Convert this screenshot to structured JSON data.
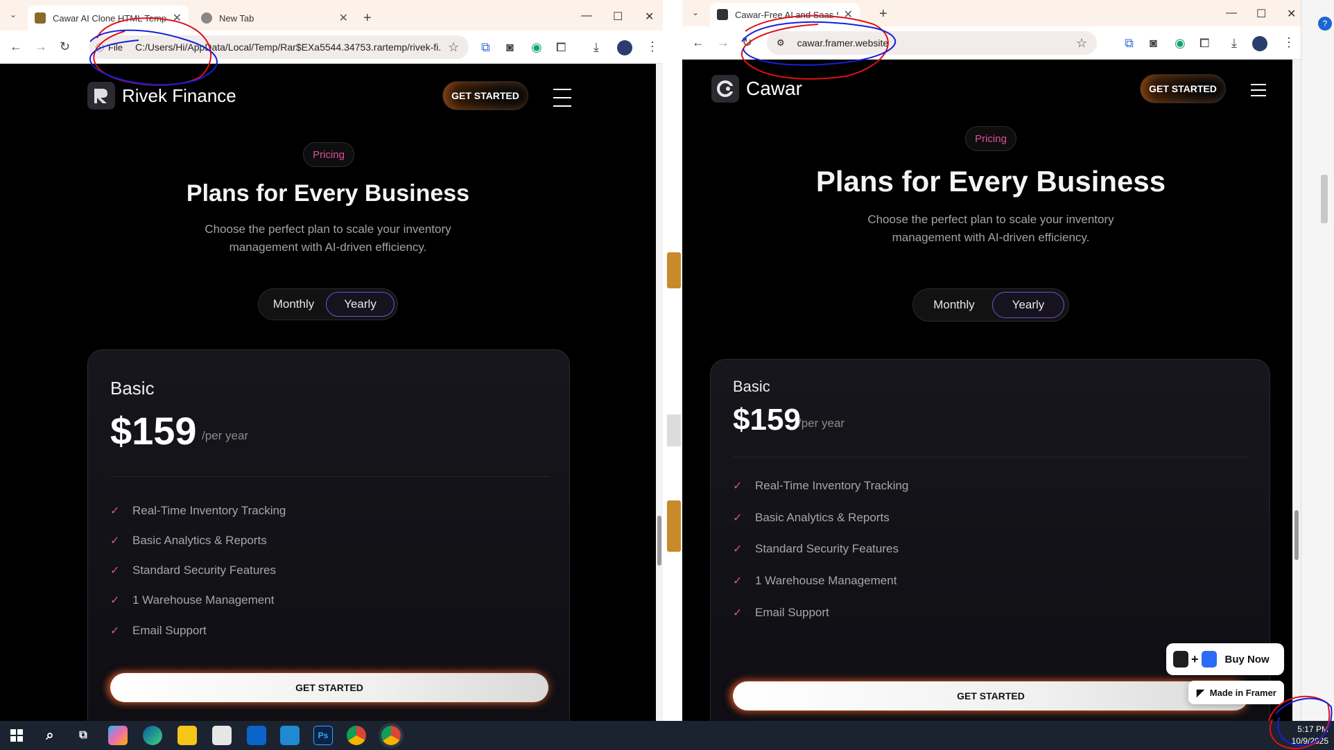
{
  "left_window": {
    "tabs": [
      {
        "title": "Cawar AI Clone HTML Template",
        "active": true
      },
      {
        "title": "New Tab",
        "active": false
      }
    ],
    "address": {
      "scheme_label": "File",
      "url": "C:/Users/Hi/AppData/Local/Temp/Rar$EXa5544.34753.rartemp/rivek-fi..."
    },
    "page": {
      "brand": "Rivek Finance",
      "nav_cta": "GET STARTED",
      "pill": "Pricing",
      "heading": "Plans for Every Business",
      "subtitle_line1": "Choose the perfect plan to scale your inventory",
      "subtitle_line2": "management with AI-driven efficiency.",
      "toggle": {
        "monthly": "Monthly",
        "yearly": "Yearly",
        "selected": "Yearly"
      },
      "card": {
        "plan": "Basic",
        "price": "$159",
        "period": "/per year",
        "features": [
          "Real-Time Inventory Tracking",
          "Basic Analytics & Reports",
          "Standard Security Features",
          "1 Warehouse Management",
          "Email Support"
        ],
        "cta": "GET STARTED"
      }
    }
  },
  "right_window": {
    "tabs": [
      {
        "title": "Cawar-Free AI and Saas Startup",
        "active": true
      }
    ],
    "address": {
      "url": "cawar.framer.website"
    },
    "page": {
      "brand": "Cawar",
      "nav_cta": "GET STARTED",
      "pill": "Pricing",
      "heading": "Plans for Every Business",
      "subtitle_line1": "Choose the perfect plan to scale your inventory",
      "subtitle_line2": "management with AI-driven efficiency.",
      "toggle": {
        "monthly": "Monthly",
        "yearly": "Yearly",
        "selected": "Yearly"
      },
      "card": {
        "plan": "Basic",
        "price": "$159",
        "period": "/per year",
        "features": [
          "Real-Time Inventory Tracking",
          "Basic Analytics & Reports",
          "Standard Security Features",
          "1 Warehouse Management",
          "Email Support"
        ],
        "cta": "GET STARTED"
      },
      "framer_badges": {
        "buy_now": "Buy Now",
        "made_in": "Made in Framer"
      }
    }
  },
  "taskbar": {
    "apps": [
      "start-icon",
      "search-icon",
      "task-view-icon",
      "copilot-icon",
      "edge-icon",
      "file-explorer-icon",
      "store-icon",
      "outlook-icon",
      "vscode-icon",
      "photoshop-icon",
      "chrome-icon",
      "chrome-icon"
    ],
    "photoshop_label": "Ps",
    "time": "5:17 PM",
    "date": "10/9/2025"
  },
  "colors": {
    "accent_pink": "#e14ea0",
    "toggle_border": "#6d55d8",
    "page_bg": "#000000",
    "annotation_red": "#e0101a",
    "annotation_blue": "#1420d8"
  }
}
